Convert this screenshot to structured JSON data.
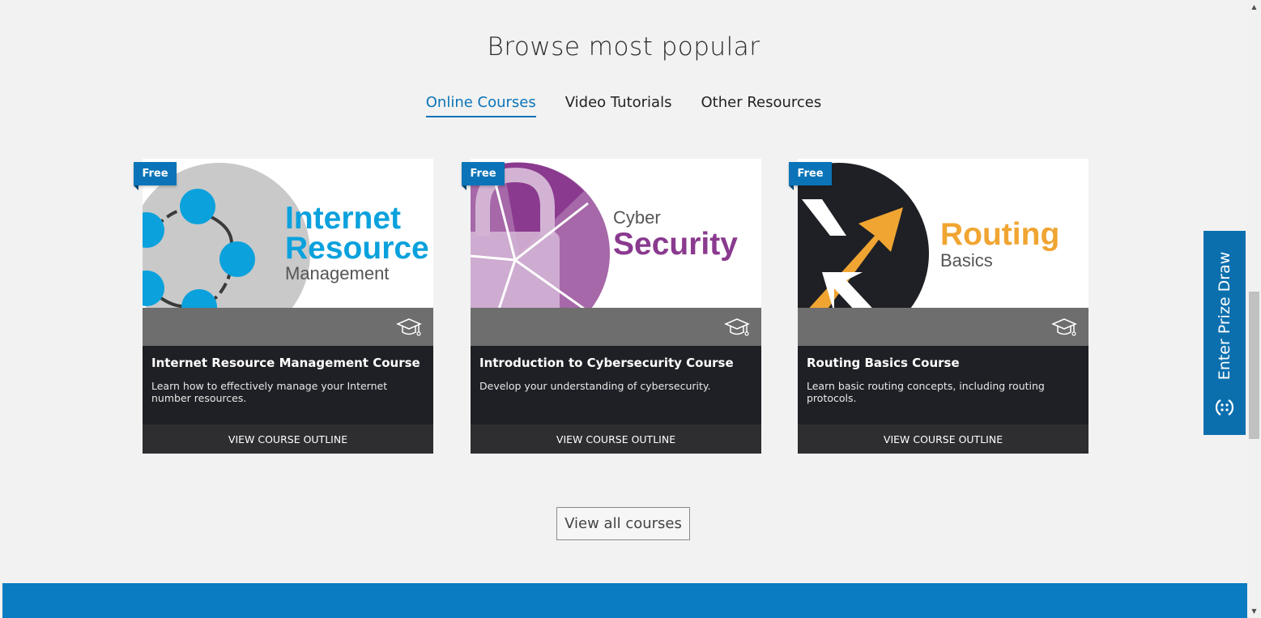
{
  "section": {
    "heading": "Browse most popular",
    "tabs": [
      {
        "label": "Online Courses",
        "active": true
      },
      {
        "label": "Video Tutorials",
        "active": false
      },
      {
        "label": "Other Resources",
        "active": false
      }
    ]
  },
  "cards": [
    {
      "badge": "Free",
      "hero_lines": [
        "Internet",
        "Resource",
        "Management"
      ],
      "title": "Internet Resource Management Course",
      "description": "Learn how to effectively manage your Internet number resources.",
      "cta": "VIEW COURSE OUTLINE",
      "accent": "#0aa1dd"
    },
    {
      "badge": "Free",
      "hero_lines": [
        "Cyber",
        "Security"
      ],
      "title": "Introduction to Cybersecurity Course",
      "description": "Develop your understanding of cybersecurity.",
      "cta": "VIEW COURSE OUTLINE",
      "accent": "#8a3a8f"
    },
    {
      "badge": "Free",
      "hero_lines": [
        "Routing",
        "Basics"
      ],
      "title": "Routing Basics Course",
      "description": "Learn basic routing concepts, including routing protocols.",
      "cta": "VIEW COURSE OUTLINE",
      "accent": "#f0a532"
    }
  ],
  "view_all": "View all courses",
  "prize_draw": {
    "label": "Enter Prize Draw",
    "icon": "smiley-chat-icon"
  },
  "colors": {
    "brand_blue": "#0b74b8",
    "footer_blue": "#0a7cc1",
    "card_dark": "#1f2025"
  }
}
